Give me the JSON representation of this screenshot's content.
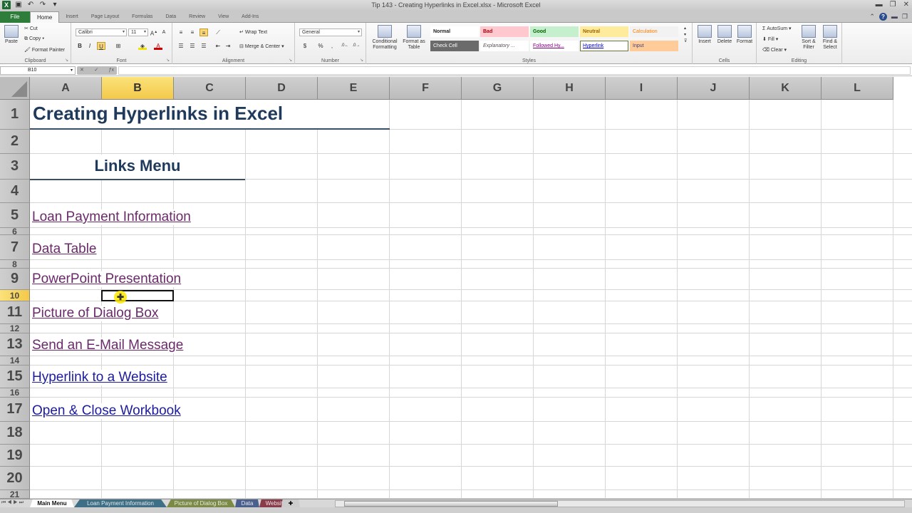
{
  "window": {
    "title": "Tip 143 - Creating Hyperlinks in Excel.xlsx - Microsoft Excel",
    "controls": [
      "minimize",
      "restore",
      "close"
    ]
  },
  "quick_access": [
    {
      "icon": "excel-logo-icon"
    },
    {
      "icon": "save-icon"
    },
    {
      "icon": "undo-icon"
    },
    {
      "icon": "redo-icon"
    },
    {
      "icon": "customize-qat-icon"
    }
  ],
  "ribbon_tabs": {
    "file": "File",
    "tabs": [
      "Home",
      "Insert",
      "Page Layout",
      "Formulas",
      "Data",
      "Review",
      "View",
      "Add-Ins"
    ],
    "active": "Home"
  },
  "ribbon": {
    "clipboard": {
      "label": "Clipboard",
      "paste": "Paste",
      "cut": "Cut",
      "copy": "Copy",
      "format_painter": "Format Painter"
    },
    "font": {
      "label": "Font",
      "font_name": "Calibri",
      "font_size": "11",
      "bold": "B",
      "italic": "I",
      "underline": "U"
    },
    "alignment": {
      "label": "Alignment",
      "wrap_text": "Wrap Text",
      "merge_center": "Merge & Center"
    },
    "number": {
      "label": "Number",
      "format": "General",
      "currency": "$",
      "percent": "%",
      "comma": ","
    },
    "styles": {
      "label": "Styles",
      "conditional_formatting": "Conditional Formatting",
      "format_as_table": "Format as Table",
      "cell_styles": [
        {
          "name": "Normal",
          "bg": "#ffffff",
          "fg": "#222222"
        },
        {
          "name": "Bad",
          "bg": "#ffc7ce",
          "fg": "#9c0006"
        },
        {
          "name": "Good",
          "bg": "#c6efce",
          "fg": "#006100"
        },
        {
          "name": "Neutral",
          "bg": "#ffeb9c",
          "fg": "#9c6500"
        },
        {
          "name": "Calculation",
          "bg": "#f2f2f2",
          "fg": "#fa7d00"
        },
        {
          "name": "Check Cell",
          "bg": "#6b6b6b",
          "fg": "#ffffff"
        },
        {
          "name": "Explanatory ...",
          "bg": "#ffffff",
          "fg": "#555555"
        },
        {
          "name": "Followed Hy...",
          "bg": "#ffffff",
          "fg": "#800080"
        },
        {
          "name": "Hyperlink",
          "bg": "#ffffff",
          "fg": "#0000cc"
        },
        {
          "name": "Input",
          "bg": "#ffcc99",
          "fg": "#3f3f76"
        }
      ]
    },
    "cells": {
      "label": "Cells",
      "insert": "Insert",
      "delete": "Delete",
      "format": "Format"
    },
    "editing": {
      "label": "Editing",
      "autosum": "AutoSum",
      "fill": "Fill",
      "clear": "Clear",
      "sort_filter": "Sort & Filter",
      "find_select": "Find & Select"
    }
  },
  "formula_bar": {
    "name_box": "B10",
    "formula": ""
  },
  "columns": [
    "A",
    "B",
    "C",
    "D",
    "E",
    "F",
    "G",
    "H",
    "I",
    "J",
    "K",
    "L"
  ],
  "selected_column": "B",
  "rows": [
    "1",
    "2",
    "3",
    "4",
    "5",
    "6",
    "7",
    "8",
    "9",
    "10",
    "11",
    "12",
    "13",
    "14",
    "15",
    "16",
    "17",
    "18",
    "19",
    "20",
    "21"
  ],
  "selected_row": "10",
  "sheet": {
    "title": "Creating Hyperlinks in Excel",
    "menu_heading": "Links Menu",
    "links": [
      {
        "text": "Loan Payment Information",
        "row": 5,
        "visited": true
      },
      {
        "text": "Data Table",
        "row": 7,
        "visited": true
      },
      {
        "text": "PowerPoint Presentation",
        "row": 9,
        "visited": true
      },
      {
        "text": "Picture of Dialog Box",
        "row": 11,
        "visited": true
      },
      {
        "text": "Send an E-Mail Message",
        "row": 13,
        "visited": true
      },
      {
        "text": "Hyperlink to a Website",
        "row": 15,
        "visited": false
      },
      {
        "text": "Open & Close Workbook",
        "row": 17,
        "visited": false
      }
    ],
    "colors": {
      "title": "#1f3a5a",
      "visited_link": "#6a2a6a",
      "link": "#1c1c9c",
      "selection": "#f3c94a"
    }
  },
  "sheet_tabs": [
    {
      "name": "Main Menu",
      "color": "#ffffff",
      "active": true
    },
    {
      "name": "Loan Payment Information",
      "color": "#3d6f86",
      "active": false
    },
    {
      "name": "Picture of Dialog Box",
      "color": "#7b8a45",
      "active": false
    },
    {
      "name": "Data",
      "color": "#4a5f8e",
      "active": false
    },
    {
      "name": "Website",
      "color": "#8a3a48",
      "active": false
    }
  ]
}
